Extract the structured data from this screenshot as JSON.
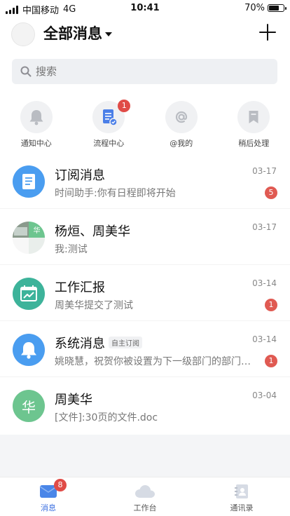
{
  "status": {
    "carrier": "中国移动",
    "network": "4G",
    "time": "10:41",
    "battery": "70%",
    "battery_level": 0.7
  },
  "header": {
    "title": "全部消息",
    "avatar_text": ""
  },
  "search": {
    "placeholder": "搜索"
  },
  "quick": [
    {
      "label": "通知中心",
      "icon": "bell-icon",
      "badge": ""
    },
    {
      "label": "流程中心",
      "icon": "workflow-doc-icon",
      "badge": "1"
    },
    {
      "label": "@我的",
      "icon": "at-icon",
      "badge": ""
    },
    {
      "label": "稍后处理",
      "icon": "bookmark-icon",
      "badge": ""
    }
  ],
  "messages": [
    {
      "title": "订阅消息",
      "tag": "",
      "date": "03-17",
      "preview": "时间助手:你有日程即将开始",
      "count": "5",
      "avatar_color": "#4a9df0",
      "icon": "document-icon"
    },
    {
      "title": "杨烜、周美华",
      "tag": "",
      "date": "03-17",
      "preview": "我:测试",
      "count": "",
      "avatar_color": "#6dc58f",
      "icon": "group-avatar-icon",
      "avatar_text": "华"
    },
    {
      "title": "工作汇报",
      "tag": "",
      "date": "03-14",
      "preview": "周美华提交了测试",
      "count": "1",
      "avatar_color": "#3db39a",
      "icon": "chart-calendar-icon"
    },
    {
      "title": "系统消息",
      "tag": "自主订阅",
      "date": "03-14",
      "preview": "姚晓慧，祝贺你被设置为下一级部门的部门…",
      "count": "1",
      "avatar_color": "#4a9df0",
      "icon": "bell-icon"
    },
    {
      "title": "周美华",
      "tag": "",
      "date": "03-04",
      "preview": "[文件]:30页的文件.doc",
      "count": "",
      "avatar_color": "#6dc58f",
      "icon": "person-avatar",
      "avatar_text": "华"
    }
  ],
  "tabs": [
    {
      "label": "消息",
      "badge": "8",
      "active": true,
      "icon": "message-icon"
    },
    {
      "label": "工作台",
      "badge": "",
      "active": false,
      "icon": "cloud-icon"
    },
    {
      "label": "通讯录",
      "badge": "",
      "active": false,
      "icon": "contacts-icon"
    }
  ]
}
